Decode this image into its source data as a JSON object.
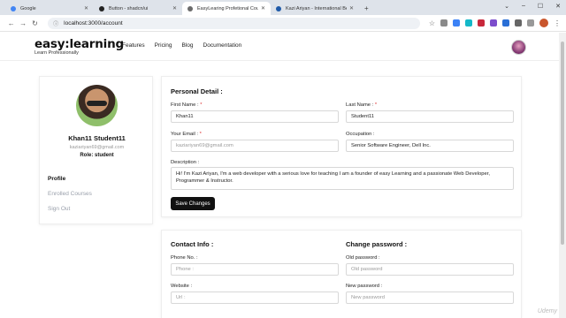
{
  "browser": {
    "tabs": [
      {
        "title": "Google",
        "color": "#4285f4"
      },
      {
        "title": "Button - shadcn/ui",
        "color": "#222222"
      },
      {
        "title": "EasyLearing Profetional Course",
        "color": "#6b6b6b"
      },
      {
        "title": "Kazi Ariyan - International Best",
        "color": "#1f5aa8"
      }
    ],
    "url": "localhost:3000/account"
  },
  "header": {
    "logo": "easy:learning",
    "tagline": "Learn Professionally",
    "nav": [
      "Features",
      "Pricing",
      "Blog",
      "Documentation"
    ]
  },
  "profile": {
    "name": "Khan11 Student11",
    "email": "kaziariyan69@gmail.com",
    "role": "Role: student",
    "menu": [
      "Profile",
      "Enrolled Courses",
      "Sign Out"
    ]
  },
  "personal": {
    "title": "Personal Detail :",
    "first_label": "First Name : ",
    "first_value": "Khan11",
    "last_label": "Last Name : ",
    "last_value": "Student11",
    "email_label": "Your Email : ",
    "email_value": "kaziariyan69@gmail.com",
    "occupation_label": "Occupation :",
    "occupation_value": "Senior Software Engineer, Dell Inc.",
    "desc_label": "Description :",
    "desc_value": "Hi! I'm Kazi Ariyan, I'm a web developer with a serious love for teaching I am a founder of easy Learning and a passionate Web Developer, Programmer & Instructor.",
    "required_mark": "*",
    "save": "Save Changes"
  },
  "contact": {
    "title": "Contact Info :",
    "phone_label": "Phone No. :",
    "phone_placeholder": "Phone :",
    "website_label": "Website :",
    "website_placeholder": "Url :"
  },
  "password": {
    "title": "Change password :",
    "old_label": "Old password :",
    "old_placeholder": "Old password",
    "new_label": "New password :",
    "new_placeholder": "New password"
  },
  "watermark": "Udemy"
}
